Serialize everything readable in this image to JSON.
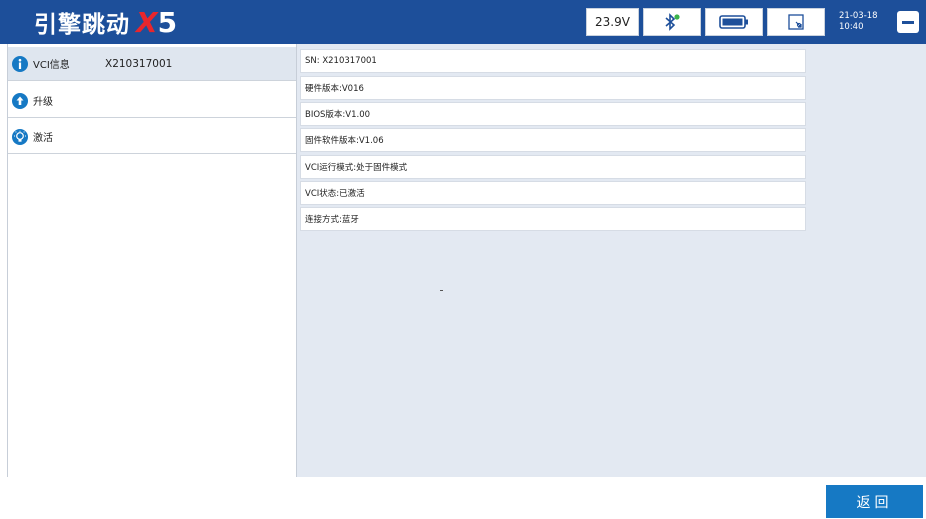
{
  "header": {
    "logo_text": "引擎跳动",
    "logo_x": "X",
    "logo_num": "5",
    "voltage": "23.9V",
    "date": "21-03-18",
    "time": "10:40",
    "bluetooth_icon": "bluetooth-connected-icon",
    "battery_icon": "battery-icon",
    "screen_icon": "screen-fit-icon",
    "minimize_icon": "minimize-icon"
  },
  "sidebar": {
    "items": [
      {
        "label": "VCI信息",
        "value": "X210317001",
        "icon": "info-icon",
        "active": true
      },
      {
        "label": "升级",
        "icon": "upgrade-arrow-icon"
      },
      {
        "label": "激活",
        "icon": "lightbulb-icon"
      }
    ]
  },
  "details": {
    "rows": [
      "SN: X210317001",
      "硬件版本:V016",
      "BIOS版本:V1.00",
      "固件软件版本:V1.06",
      "VCI运行模式:处于固件模式",
      "VCI状态:已激活",
      "连接方式:蓝牙"
    ]
  },
  "footer": {
    "back_label": "返回"
  },
  "colors": {
    "header_bg": "#1d4f9a",
    "accent": "#1679c4",
    "logo_x": "#e8262c",
    "panel_bg": "#e3e9f2"
  }
}
